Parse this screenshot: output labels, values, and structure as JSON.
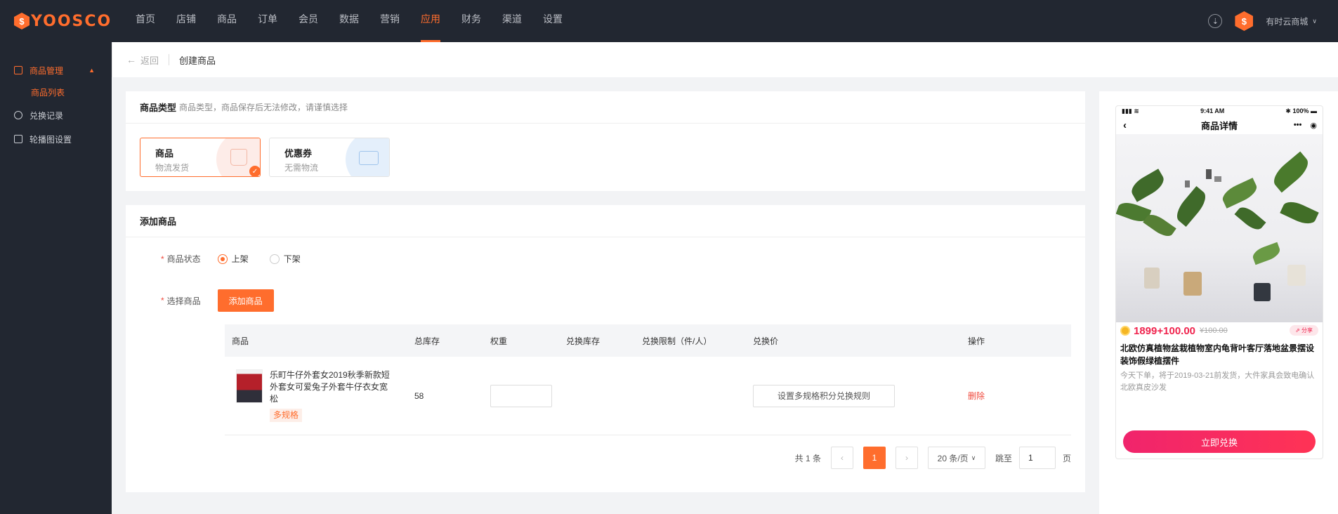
{
  "brand": {
    "logo_text": "YOOSCO",
    "logo_mark": "$"
  },
  "nav": {
    "items": [
      {
        "label": "首页"
      },
      {
        "label": "店铺"
      },
      {
        "label": "商品"
      },
      {
        "label": "订单"
      },
      {
        "label": "会员"
      },
      {
        "label": "数据"
      },
      {
        "label": "营销"
      },
      {
        "label": "应用"
      },
      {
        "label": "财务"
      },
      {
        "label": "渠道"
      },
      {
        "label": "设置"
      }
    ],
    "active_index": 7,
    "store_name": "有时云商城",
    "download_icon": "download-icon"
  },
  "sidebar": {
    "group_label": "商品管理",
    "sub_item_label": "商品列表",
    "items": [
      {
        "label": "兑换记录",
        "icon": "exchange-icon"
      },
      {
        "label": "轮播图设置",
        "icon": "carousel-icon"
      }
    ]
  },
  "breadcrumb": {
    "back_label": "返回",
    "title": "创建商品"
  },
  "type_section": {
    "title": "商品类型",
    "hint": "商品类型，商品保存后无法修改，请谨慎选择",
    "cards": [
      {
        "title": "商品",
        "subtitle": "物流发货",
        "selected": true,
        "icon": "bag-icon"
      },
      {
        "title": "优惠券",
        "subtitle": "无需物流",
        "selected": false,
        "icon": "card-icon"
      }
    ]
  },
  "add_section": {
    "title": "添加商品",
    "status_label": "商品状态",
    "status_options": [
      {
        "label": "上架",
        "checked": true
      },
      {
        "label": "下架",
        "checked": false
      }
    ],
    "select_label": "选择商品",
    "add_button": "添加商品",
    "table": {
      "headers": [
        "商品",
        "总库存",
        "权重",
        "兑换库存",
        "兑换限制（件/人）",
        "兑换价",
        "操作"
      ],
      "rows": [
        {
          "name": "乐町牛仔外套女2019秋季新款短外套女可爱兔子外套牛仔衣女宽松",
          "tag": "多规格",
          "stock": "58",
          "weight": "",
          "rule_button": "设置多规格积分兑换规则",
          "action": "删除"
        }
      ]
    },
    "pager": {
      "total": "共 1 条",
      "prev": "‹",
      "current": "1",
      "next": "›",
      "page_size": "20 条/页",
      "jump_label": "跳至",
      "jump_value": "1",
      "page_unit": "页"
    }
  },
  "preview": {
    "status_time": "9:41 AM",
    "battery": "100%",
    "nav_title": "商品详情",
    "price": "1899+100.00",
    "original_price": "¥100.00",
    "share": "分享",
    "title": "北欧仿真植物盆栽植物室内龟背叶客厅落地盆景摆设装饰假绿植摆件",
    "desc": "今天下单，将于2019-03-21前发货，大件家具会致电确认北欧真皮沙发",
    "cta": "立即兑换"
  },
  "colors": {
    "accent": "#ff6d2d",
    "nav_bg": "#222731",
    "danger": "#f04b3e",
    "cta": "#f0246c"
  }
}
